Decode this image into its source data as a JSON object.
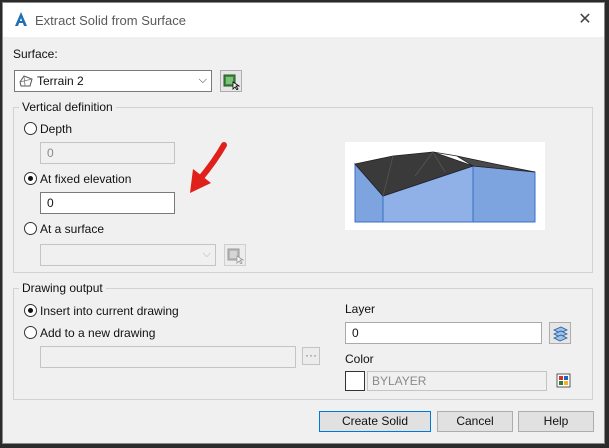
{
  "window": {
    "title": "Extract Solid from Surface"
  },
  "surface": {
    "label": "Surface:",
    "selected": "Terrain 2"
  },
  "vertical_definition": {
    "title": "Vertical definition",
    "depth": {
      "label": "Depth",
      "value": "0",
      "selected": false
    },
    "fixed_elevation": {
      "label": "At fixed elevation",
      "value": "0",
      "selected": true
    },
    "at_surface": {
      "label": "At a surface",
      "value": "",
      "selected": false
    }
  },
  "drawing_output": {
    "title": "Drawing output",
    "insert_current": {
      "label": "Insert into current drawing",
      "selected": true
    },
    "new_drawing": {
      "label": "Add to a new drawing",
      "selected": false,
      "path": ""
    },
    "browse_label": "···",
    "layer": {
      "label": "Layer",
      "value": "0"
    },
    "color": {
      "label": "Color",
      "value": "BYLAYER"
    }
  },
  "buttons": {
    "create": "Create Solid",
    "cancel": "Cancel",
    "help": "Help"
  },
  "colors": {
    "annotation_arrow": "#e0201b",
    "solid_side": "#7ea4e0",
    "solid_top": "#3a3a3a"
  }
}
